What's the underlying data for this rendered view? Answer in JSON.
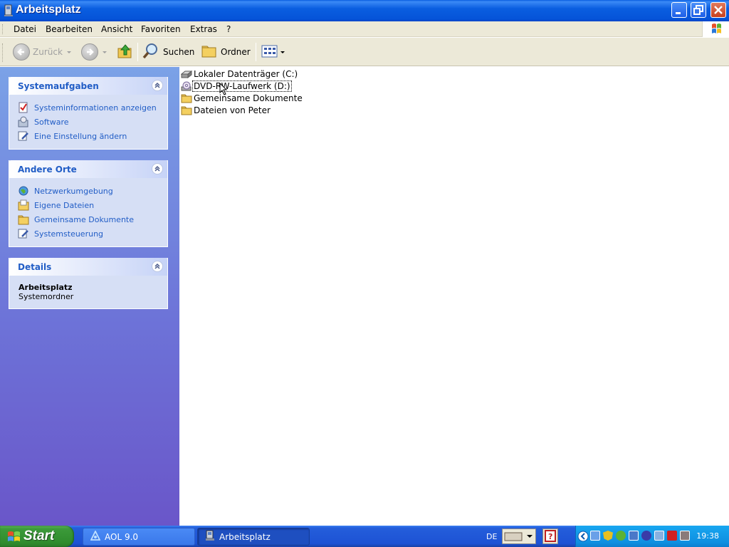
{
  "window": {
    "title": "Arbeitsplatz",
    "colors": {
      "titlebar": "#0a5ee0",
      "close": "#c8401e"
    }
  },
  "menubar": {
    "items": [
      "Datei",
      "Bearbeiten",
      "Ansicht",
      "Favoriten",
      "Extras",
      "?"
    ]
  },
  "toolbar": {
    "back_label": "Zurück",
    "search_label": "Suchen",
    "folders_label": "Ordner"
  },
  "sidebar": {
    "system_tasks": {
      "title": "Systemaufgaben",
      "items": [
        {
          "label": "Systeminformationen anzeigen",
          "icon": "system-info-icon"
        },
        {
          "label": "Software",
          "icon": "software-icon"
        },
        {
          "label": "Eine Einstellung ändern",
          "icon": "control-panel-icon"
        }
      ]
    },
    "other_places": {
      "title": "Andere Orte",
      "items": [
        {
          "label": "Netzwerkumgebung",
          "icon": "network-icon"
        },
        {
          "label": "Eigene Dateien",
          "icon": "my-documents-icon"
        },
        {
          "label": "Gemeinsame Dokumente",
          "icon": "folder-icon"
        },
        {
          "label": "Systemsteuerung",
          "icon": "control-panel-icon"
        }
      ]
    },
    "details": {
      "title": "Details",
      "name": "Arbeitsplatz",
      "type": "Systemordner"
    }
  },
  "content": {
    "items": [
      {
        "label": "Lokaler Datenträger (C:)",
        "icon": "hard-drive-icon"
      },
      {
        "label": "DVD-RW-Laufwerk (D:)",
        "icon": "dvd-drive-icon"
      },
      {
        "label": "Gemeinsame Dokumente",
        "icon": "folder-icon"
      },
      {
        "label": "Dateien von Peter",
        "icon": "folder-icon"
      }
    ]
  },
  "taskbar": {
    "start_label": "Start",
    "tasks": [
      {
        "label": "AOL 9.0",
        "icon": "aol-icon"
      },
      {
        "label": "Arbeitsplatz",
        "icon": "my-computer-icon"
      }
    ],
    "language": "DE",
    "clock": "19:38"
  }
}
